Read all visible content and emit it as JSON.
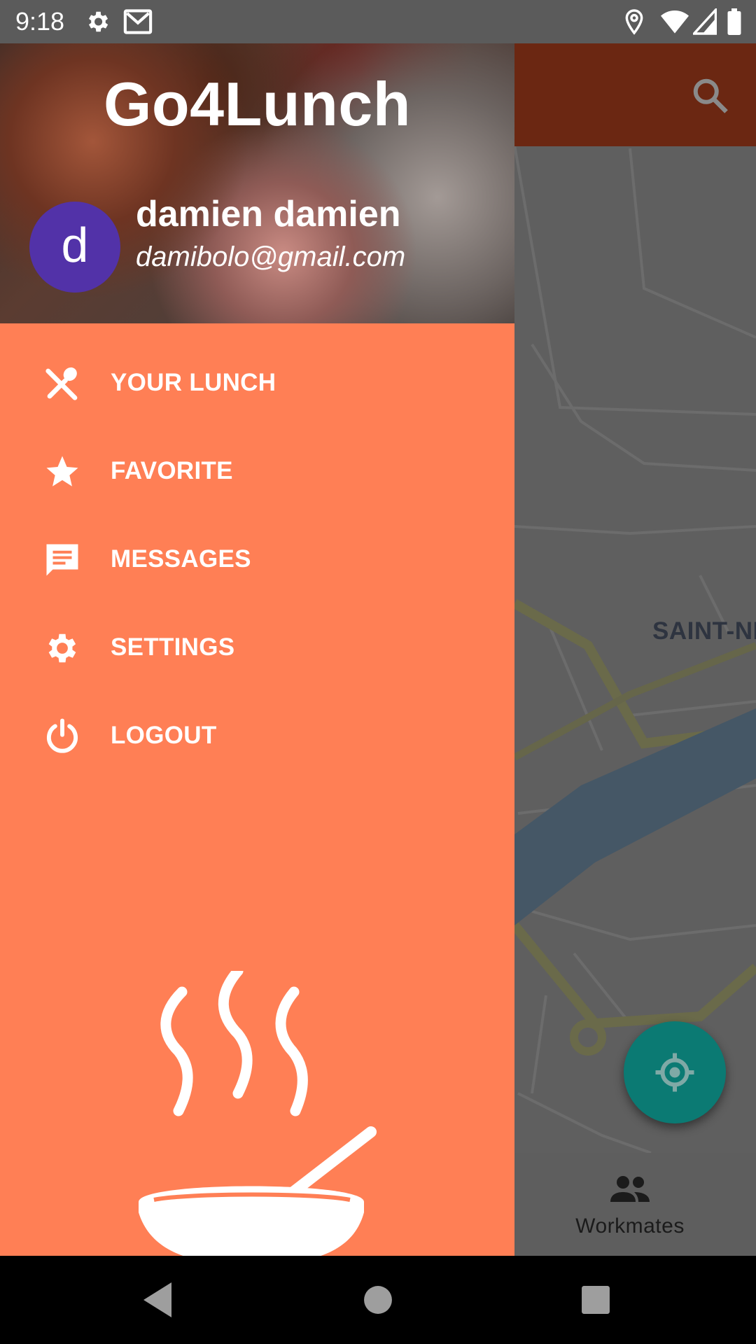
{
  "status_bar": {
    "time": "9:18",
    "left_icons": [
      "gear-icon",
      "gmail-icon"
    ],
    "right_icons": [
      "location-pin-icon",
      "wifi-icon",
      "cell-signal-icon",
      "battery-icon"
    ]
  },
  "app": {
    "toolbar_color": "#6b2712",
    "search_icon": "search-icon",
    "map_labels": [
      "SAINT-NI"
    ],
    "fab_icon": "my-location-icon",
    "bottom_nav": {
      "items": [
        {
          "label": "Workmates",
          "icon": "people-icon"
        }
      ]
    }
  },
  "drawer": {
    "app_title": "Go4Lunch",
    "avatar_letter": "d",
    "user_name": "damien damien",
    "user_email": "damibolo@gmail.com",
    "menu_items": [
      {
        "label": "YOUR LUNCH",
        "icon": "fork-spoon-icon"
      },
      {
        "label": "FAVORITE",
        "icon": "star-icon"
      },
      {
        "label": "MESSAGES",
        "icon": "message-icon"
      },
      {
        "label": "SETTINGS",
        "icon": "settings-icon"
      },
      {
        "label": "LOGOUT",
        "icon": "power-icon"
      }
    ],
    "illustration": "hot-soup-bowl-illustration",
    "background_color": "#ff7f55"
  },
  "nav_bar": {
    "buttons": [
      "back-button",
      "home-button",
      "recents-button"
    ]
  }
}
